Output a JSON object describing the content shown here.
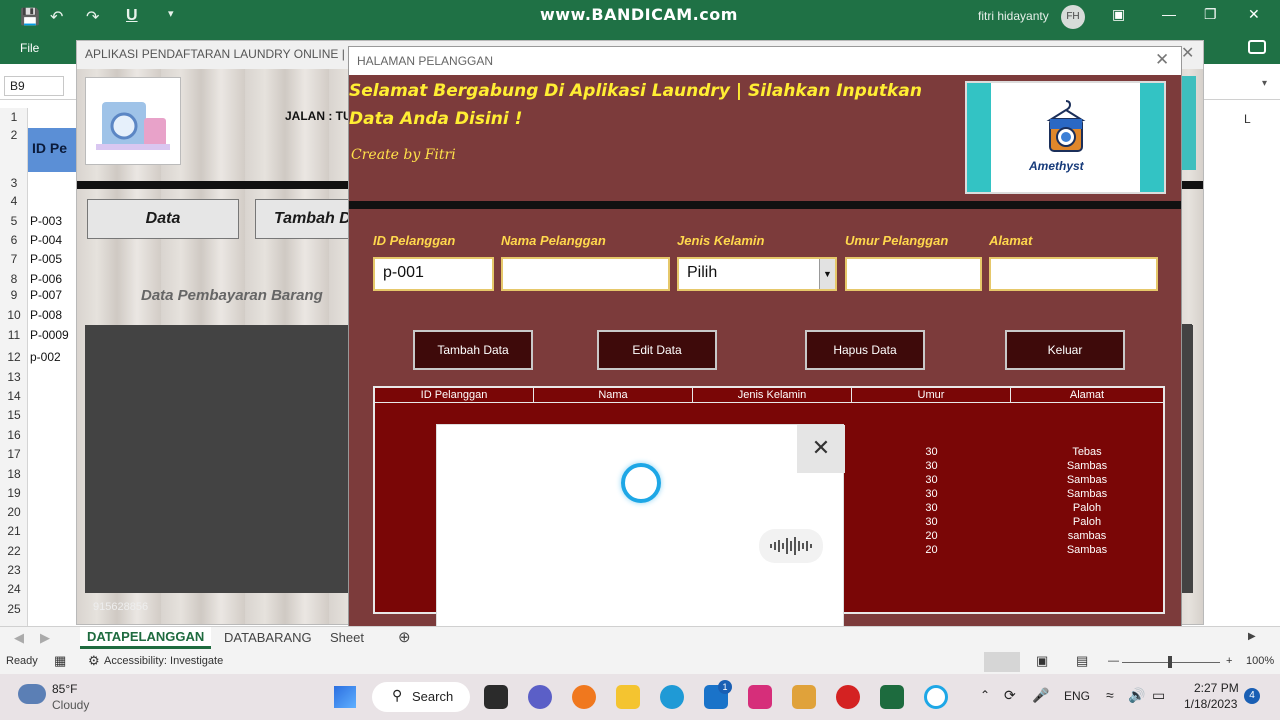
{
  "excel": {
    "watermark": "www.BANDICAM.com",
    "user_name": "fitri hidayanty",
    "user_initials": "FH",
    "file_tab": "File",
    "name_box": "B9",
    "column_l": "L",
    "id_header": "ID Pe",
    "rows": [
      "1",
      "2",
      "3",
      "4",
      "5",
      "6",
      "7",
      "8",
      "9",
      "10",
      "11",
      "12",
      "13",
      "14",
      "15",
      "16",
      "17",
      "18",
      "19",
      "20",
      "21",
      "22",
      "23",
      "24",
      "25"
    ],
    "id_cells": [
      "P-003",
      "P-004",
      "P-005",
      "P-006",
      "P-007",
      "P-008",
      "P-0009",
      "p-002"
    ]
  },
  "bg_form": {
    "title": "APLIKASI PENDAFTARAN LAUNDRY ONLINE | VBA",
    "address": "JALAN : TU",
    "btn_data": "Data",
    "btn_tambah": "Tambah D",
    "data_label": "Data Pembayaran Barang",
    "phone": "915628856"
  },
  "form": {
    "title": "HALAMAN PELANGGAN",
    "welcome": "Selamat Bergabung Di Aplikasi Laundry | Silahkan Inputkan Data Anda Disini !",
    "created_by": "Create by Fitri",
    "logo_text": "Amethyst",
    "labels": {
      "id": "ID Pelanggan",
      "nama": "Nama Pelanggan",
      "jk": "Jenis Kelamin",
      "umur": "Umur Pelanggan",
      "alamat": "Alamat"
    },
    "values": {
      "id": "p-001",
      "nama": "",
      "jk": "Pilih",
      "umur": "",
      "alamat": ""
    },
    "buttons": {
      "tambah": "Tambah Data",
      "edit": "Edit Data",
      "hapus": "Hapus Data",
      "keluar": "Keluar"
    },
    "table": {
      "headers": [
        "ID Pelanggan",
        "Nama",
        "Jenis Kelamin",
        "Umur",
        "Alamat"
      ],
      "rows": [
        {
          "umur": "30",
          "alamat": "Tebas"
        },
        {
          "umur": "30",
          "alamat": "Sambas"
        },
        {
          "umur": "30",
          "alamat": "Sambas"
        },
        {
          "umur": "30",
          "alamat": "Sambas"
        },
        {
          "umur": "30",
          "alamat": "Paloh"
        },
        {
          "umur": "30",
          "alamat": "Paloh"
        },
        {
          "umur": "20",
          "alamat": "sambas"
        },
        {
          "umur": "20",
          "alamat": "Sambas"
        }
      ]
    }
  },
  "sheets": {
    "tabs": [
      "DATAPELANGGAN",
      "DATABARANG",
      "Sheet"
    ],
    "status_ready": "Ready",
    "accessibility": "Accessibility: Investigate",
    "zoom": "100%"
  },
  "taskbar": {
    "weather_temp": "85°F",
    "weather_desc": "Cloudy",
    "search_label": "Search",
    "language": "ENG",
    "time": "2:27 PM",
    "date": "1/18/2023",
    "notif_count": "4",
    "mail_badge": "1"
  }
}
